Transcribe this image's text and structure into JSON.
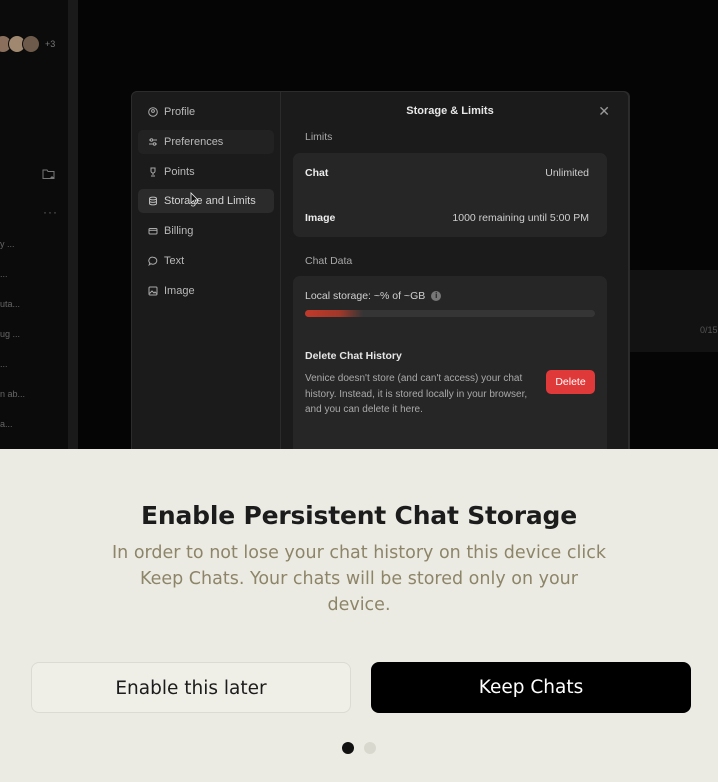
{
  "background": {
    "avatars_more": "+3",
    "list_items": [
      "y ...",
      "...",
      "uta...",
      "ug ...",
      "...",
      "n ab...",
      "a..."
    ],
    "counter": "0/15"
  },
  "dialog": {
    "title": "Storage & Limits",
    "nav": [
      {
        "label": "Profile",
        "icon": "user-icon"
      },
      {
        "label": "Preferences",
        "icon": "sliders-icon"
      },
      {
        "label": "Points",
        "icon": "trophy-icon"
      },
      {
        "label": "Storage and Limits",
        "icon": "database-icon"
      },
      {
        "label": "Billing",
        "icon": "credit-card-icon"
      },
      {
        "label": "Text",
        "icon": "chat-bubble-icon"
      },
      {
        "label": "Image",
        "icon": "image-icon"
      }
    ],
    "limits_heading": "Limits",
    "limits": [
      {
        "label": "Chat",
        "value": "Unlimited"
      },
      {
        "label": "Image",
        "value": "1000 remaining until 5:00 PM"
      }
    ],
    "chat_data_heading": "Chat Data",
    "local_storage_label": "Local storage: ~% of ~GB",
    "storage_fill_fraction": 0.2,
    "delete_title": "Delete Chat History",
    "delete_desc": "Venice doesn't store (and can't access) your chat history. Instead, it is stored locally in your browser, and you can delete it here.",
    "delete_button": "Delete"
  },
  "onboarding": {
    "headline": "Enable Persistent Chat Storage",
    "subtext": "In order to not lose your chat history on this device click Keep Chats. Your chats will be stored only on your device.",
    "secondary_button": "Enable this later",
    "primary_button": "Keep Chats",
    "pagination": {
      "current": 1,
      "total": 2
    }
  },
  "colors": {
    "delete_red": "#e0393a",
    "panel_bg": "#ecebe3",
    "subtext": "#8d8569"
  }
}
